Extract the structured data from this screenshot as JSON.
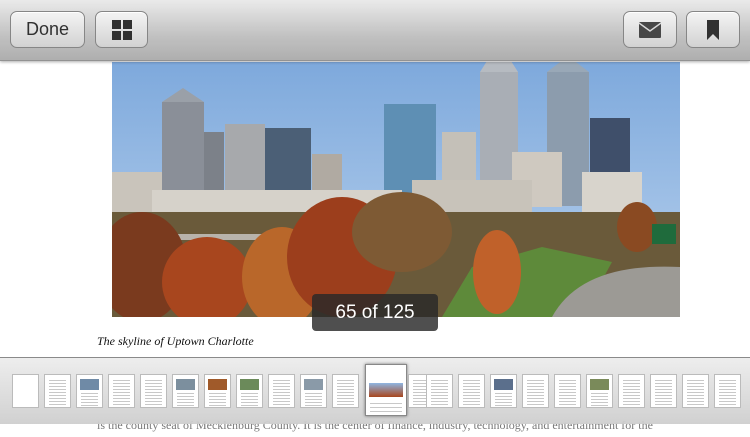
{
  "toolbar": {
    "done_label": "Done",
    "grid_icon": "grid-icon",
    "mail_icon": "mail-icon",
    "bookmark_icon": "bookmark-icon"
  },
  "page": {
    "caption": "The skyline of Uptown Charlotte",
    "body_line_2": "is the county seat of Mecklenburg County. It is the center of finance, industry, technology, and entertainment for the"
  },
  "counter": {
    "text": "65 of 125"
  },
  "colors": {
    "sky": "#8fb6e2",
    "autumn_red": "#a8461e",
    "grass": "#5e8a3a"
  }
}
